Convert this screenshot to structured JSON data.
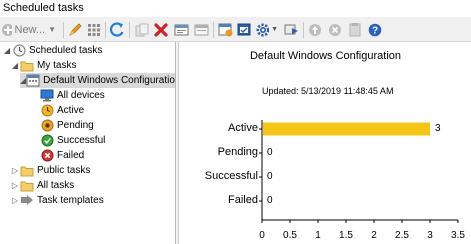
{
  "window": {
    "title": "Scheduled tasks"
  },
  "toolbar": {
    "new_label": "New...",
    "icons": [
      "plus-circle-icon",
      "pencil-icon",
      "grid-icon",
      "refresh-icon",
      "copy-icon",
      "delete-icon",
      "export-icon",
      "import-icon",
      "properties-icon",
      "calendar-icon",
      "gear-icon",
      "run-icon",
      "up-icon",
      "stop-icon",
      "clipboard-icon",
      "help-icon"
    ]
  },
  "tree": {
    "items": [
      {
        "label": "Scheduled tasks",
        "icon": "clock-icon",
        "level": 0,
        "expanded": true
      },
      {
        "label": "My tasks",
        "icon": "folder-icon",
        "level": 1,
        "expanded": true
      },
      {
        "label": "Default Windows Configuration",
        "icon": "calendar-task-icon",
        "level": 2,
        "expanded": true,
        "selected": true
      },
      {
        "label": "All devices",
        "icon": "monitor-icon",
        "level": 3
      },
      {
        "label": "Active",
        "icon": "active-status-icon",
        "level": 3
      },
      {
        "label": "Pending",
        "icon": "pending-status-icon",
        "level": 3
      },
      {
        "label": "Successful",
        "icon": "success-status-icon",
        "level": 3
      },
      {
        "label": "Failed",
        "icon": "failed-status-icon",
        "level": 3
      },
      {
        "label": "Public tasks",
        "icon": "folder-icon",
        "level": 1,
        "expanded": false
      },
      {
        "label": "All tasks",
        "icon": "folder-icon",
        "level": 1,
        "expanded": false
      },
      {
        "label": "Task templates",
        "icon": "template-icon",
        "level": 1,
        "expanded": false
      }
    ]
  },
  "chart_data": {
    "type": "bar",
    "orientation": "horizontal",
    "title": "Default Windows Configuration",
    "subtitle": "Updated: 5/13/2019 11:48:45 AM",
    "categories": [
      "Active",
      "Pending",
      "Successful",
      "Failed"
    ],
    "values": [
      3,
      0,
      0,
      0
    ],
    "xlim": [
      0,
      3.5
    ],
    "xticks": [
      "0",
      "0.5",
      "1",
      "1.5",
      "2",
      "2.5",
      "3",
      "3.5"
    ],
    "bar_color": "#f5c518",
    "grid": false
  }
}
